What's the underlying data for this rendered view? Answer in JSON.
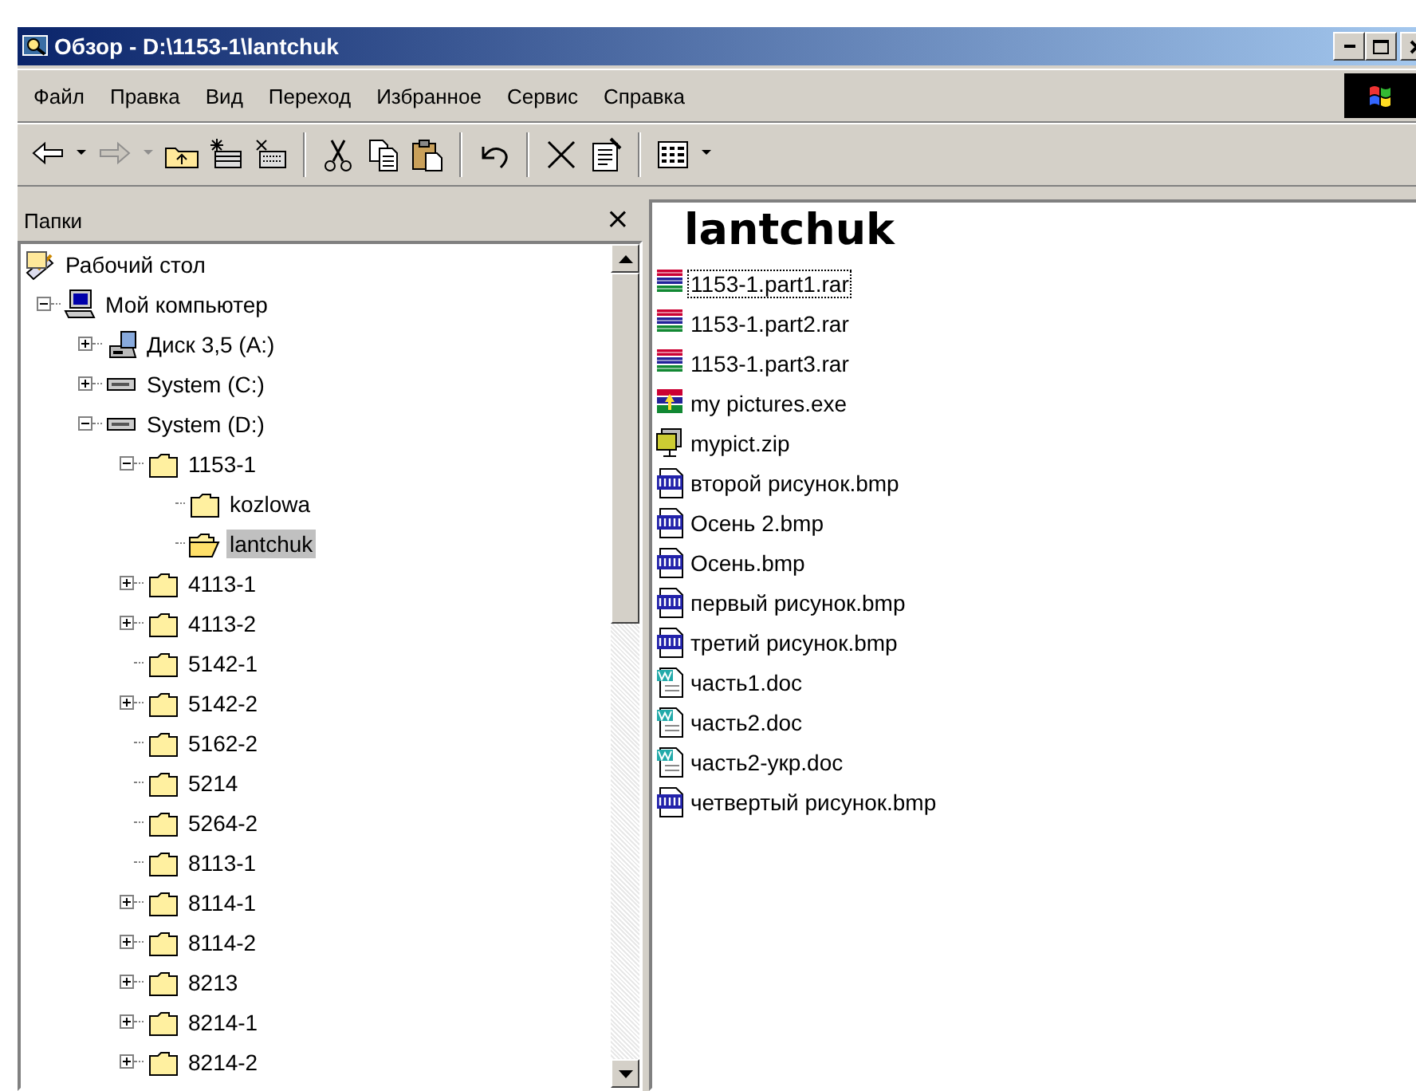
{
  "window": {
    "title": "Обзор - D:\\1153-1\\lantchuk"
  },
  "menu": [
    "Файл",
    "Правка",
    "Вид",
    "Переход",
    "Избранное",
    "Сервис",
    "Справка"
  ],
  "toolbar": [
    {
      "kind": "back",
      "disabled": false
    },
    {
      "kind": "dropdown",
      "disabled": false
    },
    {
      "kind": "forward",
      "disabled": true
    },
    {
      "kind": "dropdown",
      "disabled": true
    },
    {
      "kind": "up",
      "disabled": false
    },
    {
      "kind": "map-drive",
      "disabled": false
    },
    {
      "kind": "disconnect",
      "disabled": false
    },
    {
      "kind": "separator"
    },
    {
      "kind": "cut",
      "disabled": false
    },
    {
      "kind": "copy",
      "disabled": false
    },
    {
      "kind": "paste",
      "disabled": false
    },
    {
      "kind": "separator"
    },
    {
      "kind": "undo",
      "disabled": false
    },
    {
      "kind": "separator"
    },
    {
      "kind": "delete",
      "disabled": false
    },
    {
      "kind": "properties",
      "disabled": false
    },
    {
      "kind": "separator"
    },
    {
      "kind": "views",
      "disabled": false
    },
    {
      "kind": "dropdown",
      "disabled": false
    }
  ],
  "folders_pane": {
    "title": "Папки",
    "close": "×",
    "tree": [
      {
        "label": "Рабочий стол",
        "kind": "desktop",
        "expandable": false,
        "selected": false,
        "children": [
          {
            "label": "Мой компьютер",
            "kind": "computer",
            "expandable": true,
            "expanded": true,
            "selected": false,
            "children": [
              {
                "label": "Диск 3,5 (A:)",
                "kind": "floppy",
                "expandable": true,
                "expanded": false,
                "selected": false
              },
              {
                "label": "System (C:)",
                "kind": "drive",
                "expandable": true,
                "expanded": false,
                "selected": false
              },
              {
                "label": "System (D:)",
                "kind": "drive",
                "expandable": true,
                "expanded": true,
                "selected": false,
                "children": [
                  {
                    "label": "1153-1",
                    "kind": "folder",
                    "expandable": true,
                    "expanded": true,
                    "selected": false,
                    "children": [
                      {
                        "label": "kozlowa",
                        "kind": "folder",
                        "expandable": false,
                        "selected": false
                      },
                      {
                        "label": "lantchuk",
                        "kind": "open-folder",
                        "expandable": false,
                        "selected": true
                      }
                    ]
                  },
                  {
                    "label": "4113-1",
                    "kind": "folder",
                    "expandable": true,
                    "expanded": false,
                    "selected": false
                  },
                  {
                    "label": "4113-2",
                    "kind": "folder",
                    "expandable": true,
                    "expanded": false,
                    "selected": false
                  },
                  {
                    "label": "5142-1",
                    "kind": "folder",
                    "expandable": false,
                    "selected": false
                  },
                  {
                    "label": "5142-2",
                    "kind": "folder",
                    "expandable": true,
                    "expanded": false,
                    "selected": false
                  },
                  {
                    "label": "5162-2",
                    "kind": "folder",
                    "expandable": false,
                    "selected": false
                  },
                  {
                    "label": "5214",
                    "kind": "folder",
                    "expandable": false,
                    "selected": false
                  },
                  {
                    "label": "5264-2",
                    "kind": "folder",
                    "expandable": false,
                    "selected": false
                  },
                  {
                    "label": "8113-1",
                    "kind": "folder",
                    "expandable": false,
                    "selected": false
                  },
                  {
                    "label": "8114-1",
                    "kind": "folder",
                    "expandable": true,
                    "expanded": false,
                    "selected": false
                  },
                  {
                    "label": "8114-2",
                    "kind": "folder",
                    "expandable": true,
                    "expanded": false,
                    "selected": false
                  },
                  {
                    "label": "8213",
                    "kind": "folder",
                    "expandable": true,
                    "expanded": false,
                    "selected": false
                  },
                  {
                    "label": "8214-1",
                    "kind": "folder",
                    "expandable": true,
                    "expanded": false,
                    "selected": false
                  },
                  {
                    "label": "8214-2",
                    "kind": "folder",
                    "expandable": true,
                    "expanded": false,
                    "selected": false
                  }
                ]
              }
            ]
          }
        ]
      }
    ]
  },
  "content": {
    "heading": "lantchuk",
    "files": [
      {
        "name": "1153-1.part1.rar",
        "kind": "rar",
        "focused": true
      },
      {
        "name": "1153-1.part2.rar",
        "kind": "rar",
        "focused": false
      },
      {
        "name": "1153-1.part3.rar",
        "kind": "rar",
        "focused": false
      },
      {
        "name": "my pictures.exe",
        "kind": "exe",
        "focused": false
      },
      {
        "name": "mypict.zip",
        "kind": "zip",
        "focused": false
      },
      {
        "name": "второй рисунок.bmp",
        "kind": "bmp",
        "focused": false
      },
      {
        "name": "Осень 2.bmp",
        "kind": "bmp",
        "focused": false
      },
      {
        "name": "Осень.bmp",
        "kind": "bmp",
        "focused": false
      },
      {
        "name": "первый рисунок.bmp",
        "kind": "bmp",
        "focused": false
      },
      {
        "name": "третий рисунок.bmp",
        "kind": "bmp",
        "focused": false
      },
      {
        "name": "часть1.doc",
        "kind": "doc",
        "focused": false
      },
      {
        "name": "часть2.doc",
        "kind": "doc",
        "focused": false
      },
      {
        "name": "часть2-укр.doc",
        "kind": "doc",
        "focused": false
      },
      {
        "name": "четвертый рисунок.bmp",
        "kind": "bmp",
        "focused": false
      }
    ]
  }
}
